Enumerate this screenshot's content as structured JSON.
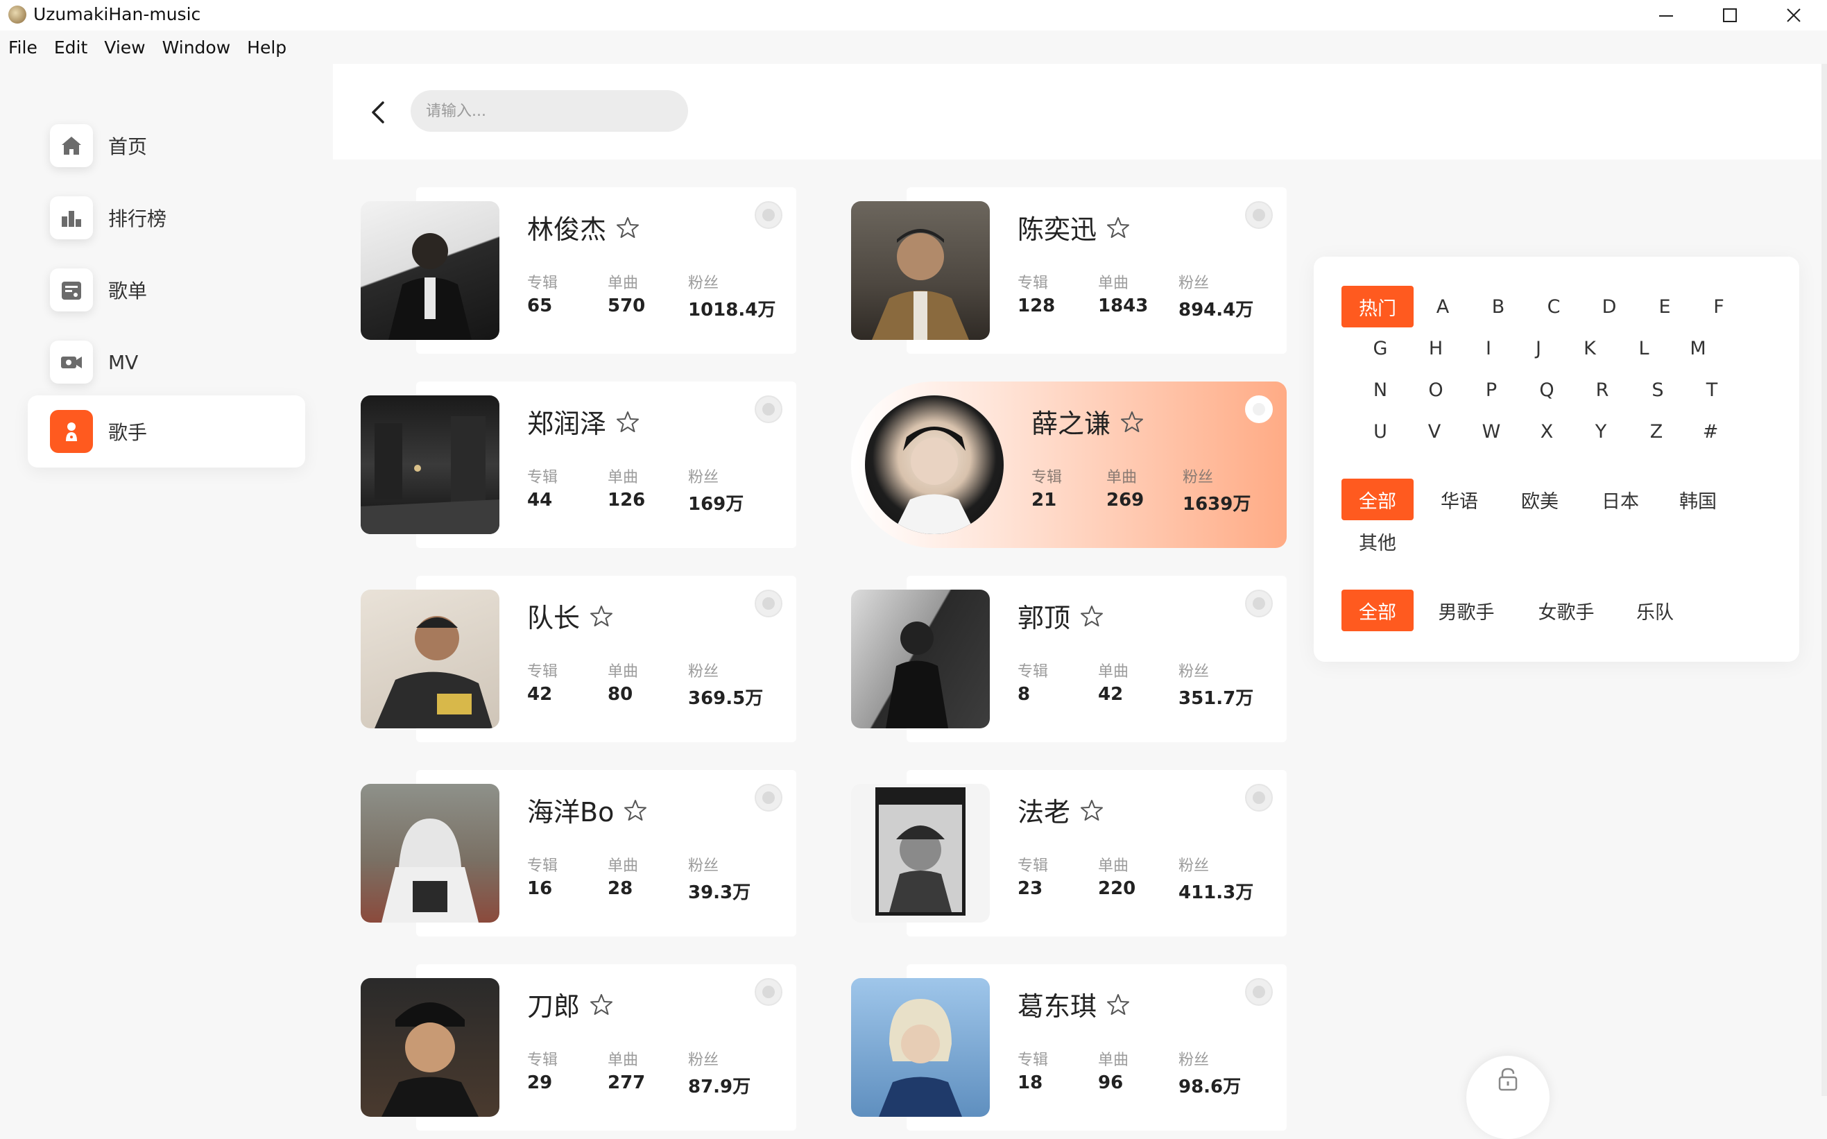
{
  "window": {
    "title": "UzumakiHan-music",
    "controls": [
      "minimize",
      "maximize",
      "close"
    ]
  },
  "menu": [
    "File",
    "Edit",
    "View",
    "Window",
    "Help"
  ],
  "sidebar": {
    "items": [
      {
        "label": "首页",
        "icon": "home-icon",
        "active": false
      },
      {
        "label": "排行榜",
        "icon": "chart-icon",
        "active": false
      },
      {
        "label": "歌单",
        "icon": "playlist-icon",
        "active": false
      },
      {
        "label": "MV",
        "icon": "video-icon",
        "active": false
      },
      {
        "label": "歌手",
        "icon": "singer-icon",
        "active": true
      }
    ]
  },
  "search": {
    "placeholder": "请输入..."
  },
  "stat_labels": {
    "albums": "专辑",
    "songs": "单曲",
    "fans": "粉丝"
  },
  "artists": [
    {
      "name": "林俊杰",
      "albums": "65",
      "songs": "570",
      "fans": "1018.4万"
    },
    {
      "name": "陈奕迅",
      "albums": "128",
      "songs": "1843",
      "fans": "894.4万"
    },
    {
      "name": "郑润泽",
      "albums": "44",
      "songs": "126",
      "fans": "169万"
    },
    {
      "name": "薛之谦",
      "albums": "21",
      "songs": "269",
      "fans": "1639万",
      "highlighted": true
    },
    {
      "name": "队长",
      "albums": "42",
      "songs": "80",
      "fans": "369.5万"
    },
    {
      "name": "郭顶",
      "albums": "8",
      "songs": "42",
      "fans": "351.7万"
    },
    {
      "name": "海洋Bo",
      "albums": "16",
      "songs": "28",
      "fans": "39.3万"
    },
    {
      "name": "法老",
      "albums": "23",
      "songs": "220",
      "fans": "411.3万"
    },
    {
      "name": "刀郎",
      "albums": "29",
      "songs": "277",
      "fans": "87.9万"
    },
    {
      "name": "葛东琪",
      "albums": "18",
      "songs": "96",
      "fans": "98.6万"
    }
  ],
  "filters": {
    "initials": [
      "热门",
      "A",
      "B",
      "C",
      "D",
      "E",
      "F",
      "G",
      "H",
      "I",
      "J",
      "K",
      "L",
      "M",
      "N",
      "O",
      "P",
      "Q",
      "R",
      "S",
      "T",
      "U",
      "V",
      "W",
      "X",
      "Y",
      "Z",
      "#"
    ],
    "initials_selected": "热门",
    "regions": [
      "全部",
      "华语",
      "欧美",
      "日本",
      "韩国",
      "其他"
    ],
    "regions_selected": "全部",
    "types": [
      "全部",
      "男歌手",
      "女歌手",
      "乐队"
    ],
    "types_selected": "全部"
  },
  "colors": {
    "accent": "#ff5a1f",
    "background": "#f7f7f7",
    "card": "#ffffff"
  }
}
